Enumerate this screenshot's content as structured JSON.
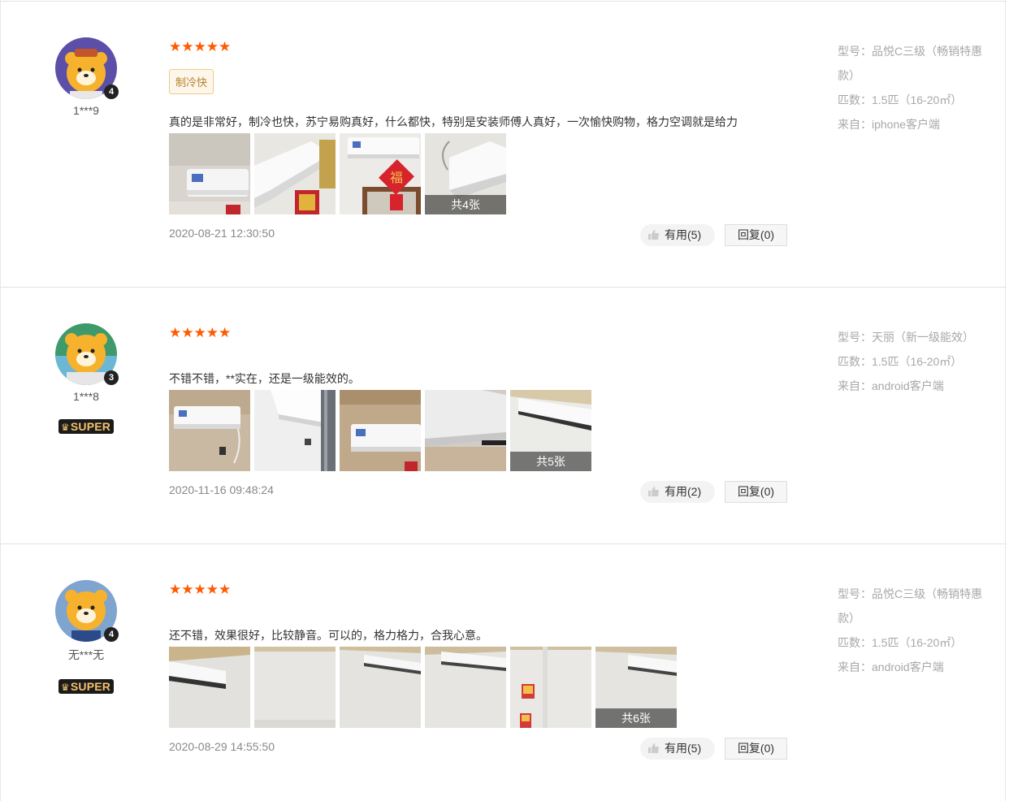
{
  "reviews": [
    {
      "username": "1***9",
      "level": "4",
      "super": false,
      "rating": "★★★★★",
      "tag": "制冷快",
      "content": "真的是非常好，制冷也快，苏宁易购真好，什么都快，特别是安装师傅人真好，一次愉快购物，格力空调就是给力",
      "photo_count": "共4张",
      "time": "2020-08-21 12:30:50",
      "useful": "有用(5)",
      "reply": "回复(0)",
      "model_line1": "型号：品悦C三级（畅销特惠",
      "model_line2": "款）",
      "power": "匹数：1.5匹（16-20㎡）",
      "source": "来自：iphone客户端"
    },
    {
      "username": "1***8",
      "level": "3",
      "super": true,
      "super_label": "SUPER",
      "rating": "★★★★★",
      "content": "不错不错，**实在，还是一级能效的。",
      "photo_count": "共5张",
      "time": "2020-11-16 09:48:24",
      "useful": "有用(2)",
      "reply": "回复(0)",
      "model_line1": "型号：天丽（新一级能效）",
      "power": "匹数：1.5匹（16-20㎡）",
      "source": "来自：android客户端"
    },
    {
      "username": "无***无",
      "level": "4",
      "super": true,
      "super_label": "SUPER",
      "rating": "★★★★★",
      "content": "还不错，效果很好，比较静音。可以的，格力格力，合我心意。",
      "photo_count": "共6张",
      "time": "2020-08-29 14:55:50",
      "useful": "有用(5)",
      "reply": "回复(0)",
      "model_line1": "型号：品悦C三级（畅销特惠",
      "model_line2": "款）",
      "power": "匹数：1.5匹（16-20㎡）",
      "source": "来自：android客户端"
    }
  ],
  "colors": {
    "star": "#ff5a00",
    "tag_border": "#f3c98b",
    "meta_text": "#a8a8a8",
    "super_bg": "#1b1b1b",
    "super_text": "#f4c26b"
  },
  "icons": [
    "lion-avatar-icon",
    "level-badge-icon",
    "crown-icon",
    "thumb-up-icon"
  ]
}
